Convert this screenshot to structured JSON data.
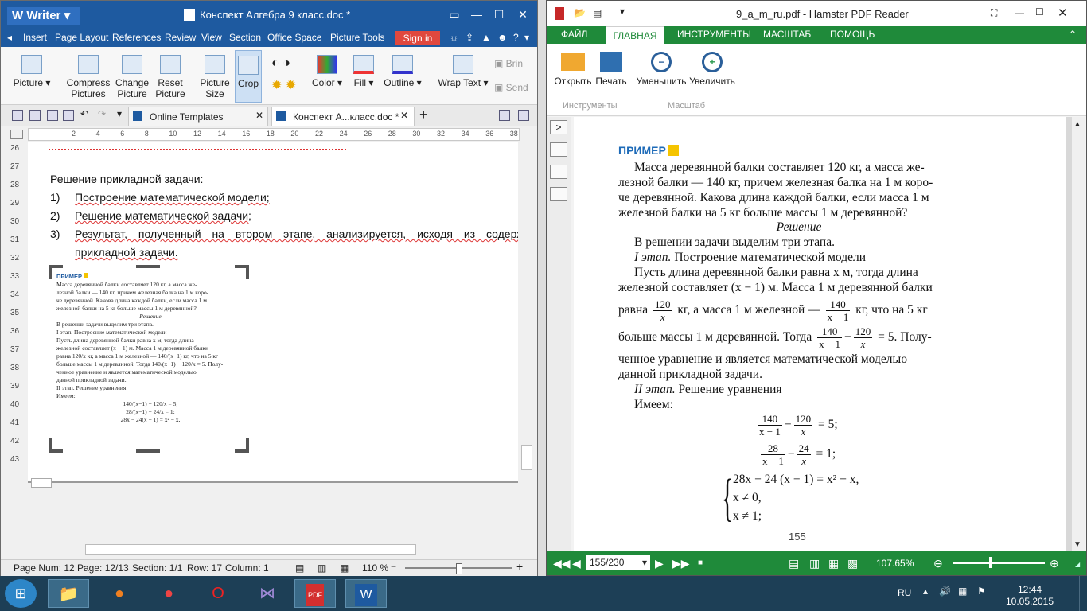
{
  "writer": {
    "app_label": "Writer",
    "title": "Конспект Алгебра 9 класс.doc *",
    "menu": [
      "Insert",
      "Page Layout",
      "References",
      "Review",
      "View",
      "Section",
      "Office Space",
      "Picture Tools"
    ],
    "signin": "Sign in",
    "ribbon": {
      "picture": "Picture",
      "compress": "Compress Pictures",
      "change": "Change Picture",
      "reset": "Reset Picture",
      "size": "Picture Size",
      "crop": "Crop",
      "color": "Color",
      "fill": "Fill",
      "outline": "Outline",
      "wrap": "Wrap Text",
      "bring": "Brin",
      "send": "Send"
    },
    "tabs": {
      "templates": "Online Templates",
      "doc": "Конспект А...класс.doc *"
    },
    "ruler_ticks": [
      "2",
      "4",
      "6",
      "8",
      "10",
      "12",
      "14",
      "16",
      "18",
      "20",
      "22",
      "24",
      "26",
      "28",
      "30",
      "32",
      "34",
      "36",
      "38"
    ],
    "line_numbers": [
      "26",
      "27",
      "28",
      "29",
      "30",
      "31",
      "32",
      "33",
      "34",
      "35",
      "36",
      "37",
      "38",
      "39",
      "40",
      "41",
      "42",
      "43"
    ],
    "heading": "Решение прикладной задачи:",
    "list": [
      {
        "num": "1)",
        "text": "Построение математической модели;"
      },
      {
        "num": "2)",
        "text": "Решение математической задачи;"
      },
      {
        "num": "3)",
        "text": "Результат, полученный на втором этапе, анализируется, исходя из содержа"
      }
    ],
    "list_cont": "прикладной задачи.",
    "image": {
      "badge": "ПРИМЕР",
      "lines": [
        "Масса деревянной балки составляет 120 кг, а масса же-",
        "лезной балки — 140 кг, причем железная балка на 1 м коро-",
        "че деревянной. Какова длина каждой балки, если масса 1 м",
        "железной балки на 5 кг больше массы 1 м деревянной?"
      ],
      "solution": "Решение",
      "lines2": [
        "В решении задачи выделим три этапа.",
        "I этап. Построение математической модели",
        "Пусть длина деревянной балки равна x м, тогда длина",
        "железной составляет (x − 1) м. Масса 1 м деревянной балки",
        "равна 120/x кг, а масса 1 м железной — 140/(x−1) кг, что на 5 кг",
        "больше массы 1 м деревянной. Тогда 140/(x−1) − 120/x = 5. Полу-",
        "ченное уравнение и является математической моделью",
        "данной прикладной задачи.",
        "II этап. Решение уравнения",
        "Имеем:",
        "140/(x−1) − 120/x = 5;",
        "28/(x−1) − 24/x = 1;",
        "28x − 24(x − 1) = x² − x,"
      ]
    },
    "status": {
      "page_num": "Page Num: 12",
      "page": "Page: 12/13",
      "section": "Section: 1/1",
      "row": "Row: 17",
      "column": "Column: 1",
      "zoom": "110 %"
    }
  },
  "pdf": {
    "title": "9_a_m_ru.pdf - Hamster PDF Reader",
    "tabs": [
      "ФАЙЛ",
      "ГЛАВНАЯ",
      "ИНСТРУМЕНТЫ",
      "МАСШТАБ",
      "ПОМОЩЬ"
    ],
    "ribbon": {
      "open": "Открыть",
      "print": "Печать",
      "zoom_out": "Уменьшить",
      "zoom_in": "Увеличить",
      "group_tools": "Инструменты",
      "group_scale": "Масштаб"
    },
    "page": {
      "badge": "ПРИМЕР",
      "p1": [
        "Масса деревянной балки составляет 120 кг, а масса же-",
        "лезной балки — 140 кг, причем железная балка на 1 м коро-",
        "че деревянной. Какова длина каждой балки, если масса 1 м",
        "железной балки на 5 кг больше массы 1 м деревянной?"
      ],
      "solution": "Решение",
      "stages": "В решении задачи выделим три этапа.",
      "stage1_label": "I этап.",
      "stage1_text": "Построение математической модели",
      "l1": "Пусть длина деревянной балки равна x м, тогда длина",
      "l2": "железной составляет (x − 1) м. Масса 1 м деревянной балки",
      "l3a": "равна",
      "l3b": "кг, а масса 1 м железной —",
      "l3c": "кг, что на 5 кг",
      "l4a": "больше массы 1 м деревянной. Тогда",
      "l4b": "= 5. Полу-",
      "l5": "ченное уравнение и является математической моделью",
      "l6": "данной прикладной задачи.",
      "stage2_label": "II этап.",
      "stage2_text": "Решение уравнения",
      "have": "Имеем:",
      "eq1_tail": "= 5;",
      "eq2_tail": "= 1;",
      "sys1": "28x − 24 (x − 1) = x² − x,",
      "sys2": "x ≠ 0,",
      "sys3": "x ≠ 1;",
      "page_no": "155",
      "fr": {
        "n120": "120",
        "d_x": "x",
        "n140": "140",
        "d_x1": "x − 1",
        "n28": "28",
        "n24": "24"
      }
    },
    "nav": {
      "page_field": "155/230",
      "zoom": "107.65%"
    }
  },
  "taskbar": {
    "lang": "RU",
    "time": "12:44",
    "date": "10.05.2015"
  }
}
